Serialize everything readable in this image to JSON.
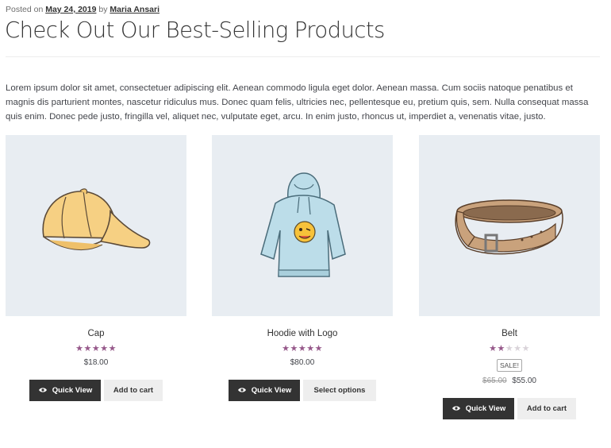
{
  "meta": {
    "posted_on": "Posted on",
    "date": "May 24, 2019",
    "by": "by",
    "author": "Maria Ansari"
  },
  "title": "Check Out Our Best-Selling Products",
  "excerpt": "Lorem ipsum dolor sit amet, consectetuer adipiscing elit. Aenean commodo ligula eget dolor. Aenean massa. Cum sociis natoque penatibus et magnis dis parturient montes, nascetur ridiculus mus. Donec quam felis, ultricies nec, pellentesque eu, pretium quis, sem. Nulla consequat massa quis enim. Donec pede justo, fringilla vel, aliquet nec, vulputate eget, arcu. In enim justo, rhoncus ut, imperdiet a, venenatis vitae, justo.",
  "colors": {
    "star": "#96588a",
    "button_dark": "#333333",
    "thumb_bg": "#e8edf2"
  },
  "products": [
    {
      "name": "Cap",
      "rating": 5,
      "price": "$18.00",
      "image_icon": "cap-icon",
      "quick_view": "Quick View",
      "action": "Add to cart"
    },
    {
      "name": "Hoodie with Logo",
      "rating": 5,
      "price": "$80.00",
      "image_icon": "hoodie-icon",
      "quick_view": "Quick View",
      "action": "Select options"
    },
    {
      "name": "Belt",
      "rating": 2,
      "sale_badge": "SALE!",
      "regular_price": "$65.00",
      "price": "$55.00",
      "image_icon": "belt-icon",
      "quick_view": "Quick View",
      "action": "Add to cart"
    }
  ]
}
